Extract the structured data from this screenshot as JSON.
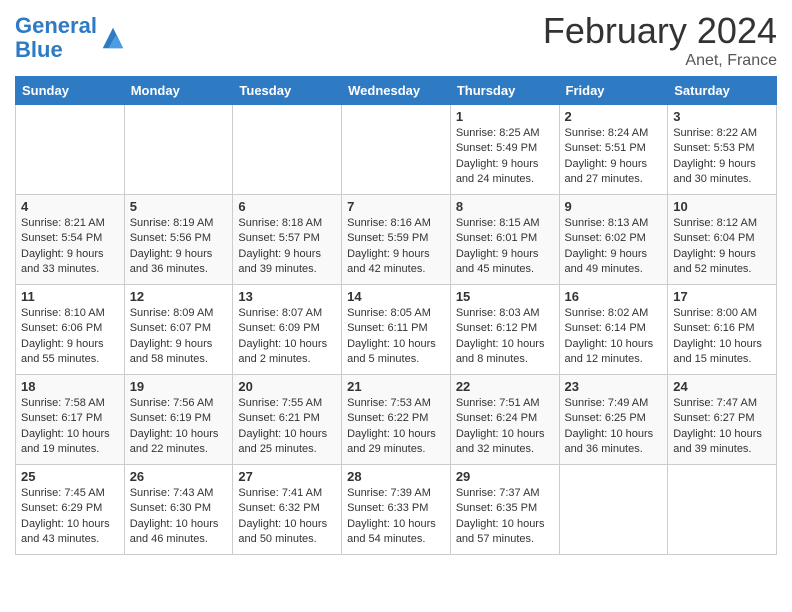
{
  "header": {
    "logo_line1": "General",
    "logo_line2": "Blue",
    "title": "February 2024",
    "subtitle": "Anet, France"
  },
  "columns": [
    "Sunday",
    "Monday",
    "Tuesday",
    "Wednesday",
    "Thursday",
    "Friday",
    "Saturday"
  ],
  "weeks": [
    [
      {
        "day": "",
        "info": ""
      },
      {
        "day": "",
        "info": ""
      },
      {
        "day": "",
        "info": ""
      },
      {
        "day": "",
        "info": ""
      },
      {
        "day": "1",
        "info": "Sunrise: 8:25 AM\nSunset: 5:49 PM\nDaylight: 9 hours and 24 minutes."
      },
      {
        "day": "2",
        "info": "Sunrise: 8:24 AM\nSunset: 5:51 PM\nDaylight: 9 hours and 27 minutes."
      },
      {
        "day": "3",
        "info": "Sunrise: 8:22 AM\nSunset: 5:53 PM\nDaylight: 9 hours and 30 minutes."
      }
    ],
    [
      {
        "day": "4",
        "info": "Sunrise: 8:21 AM\nSunset: 5:54 PM\nDaylight: 9 hours and 33 minutes."
      },
      {
        "day": "5",
        "info": "Sunrise: 8:19 AM\nSunset: 5:56 PM\nDaylight: 9 hours and 36 minutes."
      },
      {
        "day": "6",
        "info": "Sunrise: 8:18 AM\nSunset: 5:57 PM\nDaylight: 9 hours and 39 minutes."
      },
      {
        "day": "7",
        "info": "Sunrise: 8:16 AM\nSunset: 5:59 PM\nDaylight: 9 hours and 42 minutes."
      },
      {
        "day": "8",
        "info": "Sunrise: 8:15 AM\nSunset: 6:01 PM\nDaylight: 9 hours and 45 minutes."
      },
      {
        "day": "9",
        "info": "Sunrise: 8:13 AM\nSunset: 6:02 PM\nDaylight: 9 hours and 49 minutes."
      },
      {
        "day": "10",
        "info": "Sunrise: 8:12 AM\nSunset: 6:04 PM\nDaylight: 9 hours and 52 minutes."
      }
    ],
    [
      {
        "day": "11",
        "info": "Sunrise: 8:10 AM\nSunset: 6:06 PM\nDaylight: 9 hours and 55 minutes."
      },
      {
        "day": "12",
        "info": "Sunrise: 8:09 AM\nSunset: 6:07 PM\nDaylight: 9 hours and 58 minutes."
      },
      {
        "day": "13",
        "info": "Sunrise: 8:07 AM\nSunset: 6:09 PM\nDaylight: 10 hours and 2 minutes."
      },
      {
        "day": "14",
        "info": "Sunrise: 8:05 AM\nSunset: 6:11 PM\nDaylight: 10 hours and 5 minutes."
      },
      {
        "day": "15",
        "info": "Sunrise: 8:03 AM\nSunset: 6:12 PM\nDaylight: 10 hours and 8 minutes."
      },
      {
        "day": "16",
        "info": "Sunrise: 8:02 AM\nSunset: 6:14 PM\nDaylight: 10 hours and 12 minutes."
      },
      {
        "day": "17",
        "info": "Sunrise: 8:00 AM\nSunset: 6:16 PM\nDaylight: 10 hours and 15 minutes."
      }
    ],
    [
      {
        "day": "18",
        "info": "Sunrise: 7:58 AM\nSunset: 6:17 PM\nDaylight: 10 hours and 19 minutes."
      },
      {
        "day": "19",
        "info": "Sunrise: 7:56 AM\nSunset: 6:19 PM\nDaylight: 10 hours and 22 minutes."
      },
      {
        "day": "20",
        "info": "Sunrise: 7:55 AM\nSunset: 6:21 PM\nDaylight: 10 hours and 25 minutes."
      },
      {
        "day": "21",
        "info": "Sunrise: 7:53 AM\nSunset: 6:22 PM\nDaylight: 10 hours and 29 minutes."
      },
      {
        "day": "22",
        "info": "Sunrise: 7:51 AM\nSunset: 6:24 PM\nDaylight: 10 hours and 32 minutes."
      },
      {
        "day": "23",
        "info": "Sunrise: 7:49 AM\nSunset: 6:25 PM\nDaylight: 10 hours and 36 minutes."
      },
      {
        "day": "24",
        "info": "Sunrise: 7:47 AM\nSunset: 6:27 PM\nDaylight: 10 hours and 39 minutes."
      }
    ],
    [
      {
        "day": "25",
        "info": "Sunrise: 7:45 AM\nSunset: 6:29 PM\nDaylight: 10 hours and 43 minutes."
      },
      {
        "day": "26",
        "info": "Sunrise: 7:43 AM\nSunset: 6:30 PM\nDaylight: 10 hours and 46 minutes."
      },
      {
        "day": "27",
        "info": "Sunrise: 7:41 AM\nSunset: 6:32 PM\nDaylight: 10 hours and 50 minutes."
      },
      {
        "day": "28",
        "info": "Sunrise: 7:39 AM\nSunset: 6:33 PM\nDaylight: 10 hours and 54 minutes."
      },
      {
        "day": "29",
        "info": "Sunrise: 7:37 AM\nSunset: 6:35 PM\nDaylight: 10 hours and 57 minutes."
      },
      {
        "day": "",
        "info": ""
      },
      {
        "day": "",
        "info": ""
      }
    ]
  ]
}
